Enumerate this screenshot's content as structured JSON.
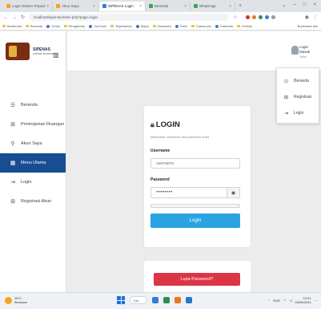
{
  "browser": {
    "tabs": [
      {
        "label": "Login Sistem Terpadu",
        "icon": "orange"
      },
      {
        "label": "Akun Saya",
        "icon": "orange"
      },
      {
        "label": "SIPENAS Login",
        "icon": "blue",
        "active": true
      },
      {
        "label": "Beranda",
        "icon": "green"
      },
      {
        "label": "WhatsApp",
        "icon": "green"
      }
    ],
    "url": "localhost/sipenas/index.php?page=login",
    "bookmarks": [
      "Bookmark",
      "Beranda",
      "Gmail",
      "Pengaturan",
      "YouTube",
      "Terjemahan",
      "Maps",
      "Dokumen",
      "Drive",
      "Classroom",
      "Kalender",
      "Kontak",
      "Berita"
    ],
    "bookmarks_end": "Bookmark lain"
  },
  "app": {
    "logo_title": "SIPENAS",
    "logo_subtitle": "SISTEM INFORMASI"
  },
  "sidebar": {
    "items": [
      {
        "icon": "☰",
        "label": "Beranda"
      },
      {
        "icon": "⊞",
        "label": "Peminjaman Ruangan"
      },
      {
        "icon": "⚲",
        "label": "Akun Saya"
      },
      {
        "icon": "▦",
        "label": "Menu Utama",
        "active": true
      },
      {
        "icon": "⇥",
        "label": "Login"
      },
      {
        "icon": "⊞",
        "label": "Registrasi Akun"
      }
    ]
  },
  "topbar": {
    "user_name": "Login Masuk",
    "user_sub": "Tamu"
  },
  "dropdown": {
    "items": [
      {
        "icon": "⊙",
        "label": "Beranda"
      },
      {
        "icon": "⊞",
        "label": "Registrasi"
      },
      {
        "icon": "⇥",
        "label": "Login"
      }
    ]
  },
  "login": {
    "title": "LOGIN",
    "subtitle": "Masukkan username dan password anda",
    "username_label": "Username",
    "username_value": "username",
    "password_label": "Password",
    "password_value": "••••••••",
    "password_strength": 0.0,
    "submit": "Login"
  },
  "forgot": {
    "button": "Lupa Password?"
  },
  "taskbar": {
    "weather_temp": "28°C",
    "weather_desc": "Berawan",
    "search_label": "Cari",
    "lang": "ENG",
    "time": "10:21",
    "date": "03/06/2024"
  },
  "colors": {
    "sidebar_active": "#174d92",
    "login_button": "#2aa3e0",
    "forgot_button": "#dc3545"
  }
}
